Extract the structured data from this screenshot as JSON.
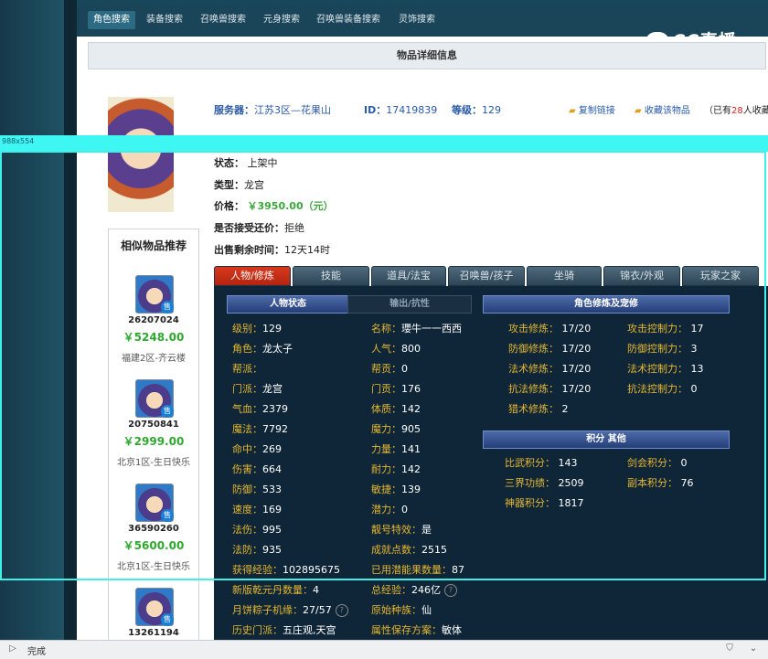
{
  "nav": {
    "tabs": [
      {
        "label": "角色搜索",
        "active": true
      },
      {
        "label": "装备搜索"
      },
      {
        "label": "召唤兽搜索"
      },
      {
        "label": "元身搜索"
      },
      {
        "label": "召唤兽装备搜索"
      },
      {
        "label": "灵饰搜索"
      }
    ],
    "logo": "CC直播"
  },
  "detail": {
    "title": "物品详细信息",
    "server_label": "服务器：",
    "server_value": "江苏3区—花果山",
    "id_label": "ID：",
    "id_value": "17419839",
    "level_label": "等级：",
    "level_value": "129",
    "copy_link": "复制链接",
    "favorite": "收藏该物品",
    "fav_count_prefix": "（已有",
    "fav_count": "28",
    "fav_count_suffix": "人收藏）",
    "status_label": "状态：",
    "status_value": "上架中",
    "type_label": "类型：",
    "type_value": "龙宫",
    "price_label": "价格：",
    "price_value": "￥3950.00（元）",
    "bargain_label": "是否接受还价：",
    "bargain_value": "拒绝",
    "remaining_label": "出售剩余时间：",
    "remaining_value": "12天14时"
  },
  "overlay": {
    "label": "988x554"
  },
  "similar": {
    "title": "相似物品推荐",
    "items": [
      {
        "id": "26207024",
        "price": "￥5248.00",
        "server": "福建2区-齐云楼"
      },
      {
        "id": "20750841",
        "price": "￥2999.00",
        "server": "北京1区-生日快乐"
      },
      {
        "id": "36590260",
        "price": "￥5600.00",
        "server": "北京1区-生日快乐"
      },
      {
        "id": "13261194"
      }
    ]
  },
  "tabs": [
    "人物/修炼",
    "技能",
    "道具/法宝",
    "召唤兽/孩子",
    "坐骑",
    "锦衣/外观",
    "玩家之家"
  ],
  "panel": {
    "status_header": "人物状态",
    "output_header": "输出/抗性",
    "left_col": [
      {
        "k": "级别：",
        "v": "129"
      },
      {
        "k": "角色：",
        "v": "龙太子"
      },
      {
        "k": "帮派：",
        "v": ""
      },
      {
        "k": "门派：",
        "v": "龙宫"
      },
      {
        "k": "气血：",
        "v": "2379"
      },
      {
        "k": "魔法：",
        "v": "7792"
      },
      {
        "k": "命中：",
        "v": "269"
      },
      {
        "k": "伤害：",
        "v": "664"
      },
      {
        "k": "防御：",
        "v": "533"
      },
      {
        "k": "速度：",
        "v": "169"
      },
      {
        "k": "法伤：",
        "v": "995"
      },
      {
        "k": "法防：",
        "v": "935"
      },
      {
        "k": "获得经验：",
        "v": "102895675"
      },
      {
        "k": "新版乾元丹数量：",
        "v": "4"
      },
      {
        "k": "月饼粽子机缘：",
        "v": "27/57"
      },
      {
        "k": "历史门派：",
        "v": "五庄观,天宫"
      }
    ],
    "mid_col": [
      {
        "k": "名称：",
        "v": "瓔牛一一西西"
      },
      {
        "k": "人气：",
        "v": "800"
      },
      {
        "k": "帮贡：",
        "v": "0"
      },
      {
        "k": "门贡：",
        "v": "176"
      },
      {
        "k": "体质：",
        "v": "142"
      },
      {
        "k": "魔力：",
        "v": "905"
      },
      {
        "k": "力量：",
        "v": "141"
      },
      {
        "k": "耐力：",
        "v": "142"
      },
      {
        "k": "敏捷：",
        "v": "139"
      },
      {
        "k": "潜力：",
        "v": "0"
      },
      {
        "k": "靓号特效：",
        "v": "是"
      },
      {
        "k": "成就点数：",
        "v": "2515"
      },
      {
        "k": "已用潜能果数量：",
        "v": "87"
      },
      {
        "k": "总经验：",
        "v": "246亿"
      },
      {
        "k": "原始种族：",
        "v": "仙"
      },
      {
        "k": "属性保存方案：",
        "v": "敏体"
      }
    ],
    "cultivation_header": "角色修炼及宠修",
    "cult_left": [
      {
        "k": "攻击修炼：",
        "v": "17/20"
      },
      {
        "k": "防御修炼：",
        "v": "17/20"
      },
      {
        "k": "法术修炼：",
        "v": "17/20"
      },
      {
        "k": "抗法修炼：",
        "v": "17/20"
      },
      {
        "k": "猎术修炼：",
        "v": "2"
      }
    ],
    "cult_right": [
      {
        "k": "攻击控制力：",
        "v": "17"
      },
      {
        "k": "防御控制力：",
        "v": "3"
      },
      {
        "k": "法术控制力：",
        "v": "13"
      },
      {
        "k": "抗法控制力：",
        "v": "0"
      }
    ],
    "score_header": "积分  其他",
    "score_left": [
      {
        "k": "比武积分：",
        "v": "143"
      },
      {
        "k": "三界功绩：",
        "v": "2509"
      },
      {
        "k": "神器积分：",
        "v": "1817"
      }
    ],
    "score_right": [
      {
        "k": "剑会积分：",
        "v": "0"
      },
      {
        "k": "副本积分：",
        "v": "76"
      }
    ]
  },
  "statusbar": {
    "text": "完成"
  }
}
